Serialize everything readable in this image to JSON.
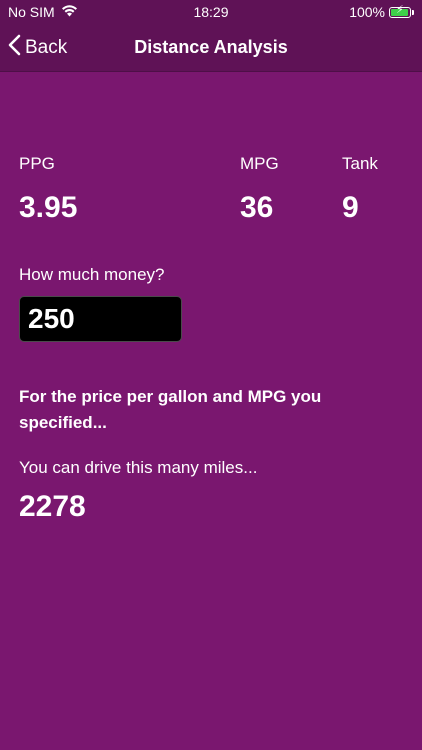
{
  "status_bar": {
    "carrier": "No SIM",
    "time": "18:29",
    "battery": "100%",
    "battery_level": 1.0
  },
  "nav": {
    "back_label": "Back",
    "title": "Distance Analysis"
  },
  "stats": {
    "ppg_label": "PPG",
    "ppg_value": "3.95",
    "mpg_label": "MPG",
    "mpg_value": "36",
    "tank_label": "Tank",
    "tank_value": "9"
  },
  "money": {
    "label": "How much money?",
    "value": "250"
  },
  "result": {
    "explanation": "For the price per gallon and MPG you specified...",
    "miles_label": "You can drive this many miles...",
    "miles_value": "2278"
  },
  "colors": {
    "background": "#7a176f",
    "bar": "#5f1256",
    "input_bg": "#000000",
    "battery_fill": "#3fd04a"
  }
}
